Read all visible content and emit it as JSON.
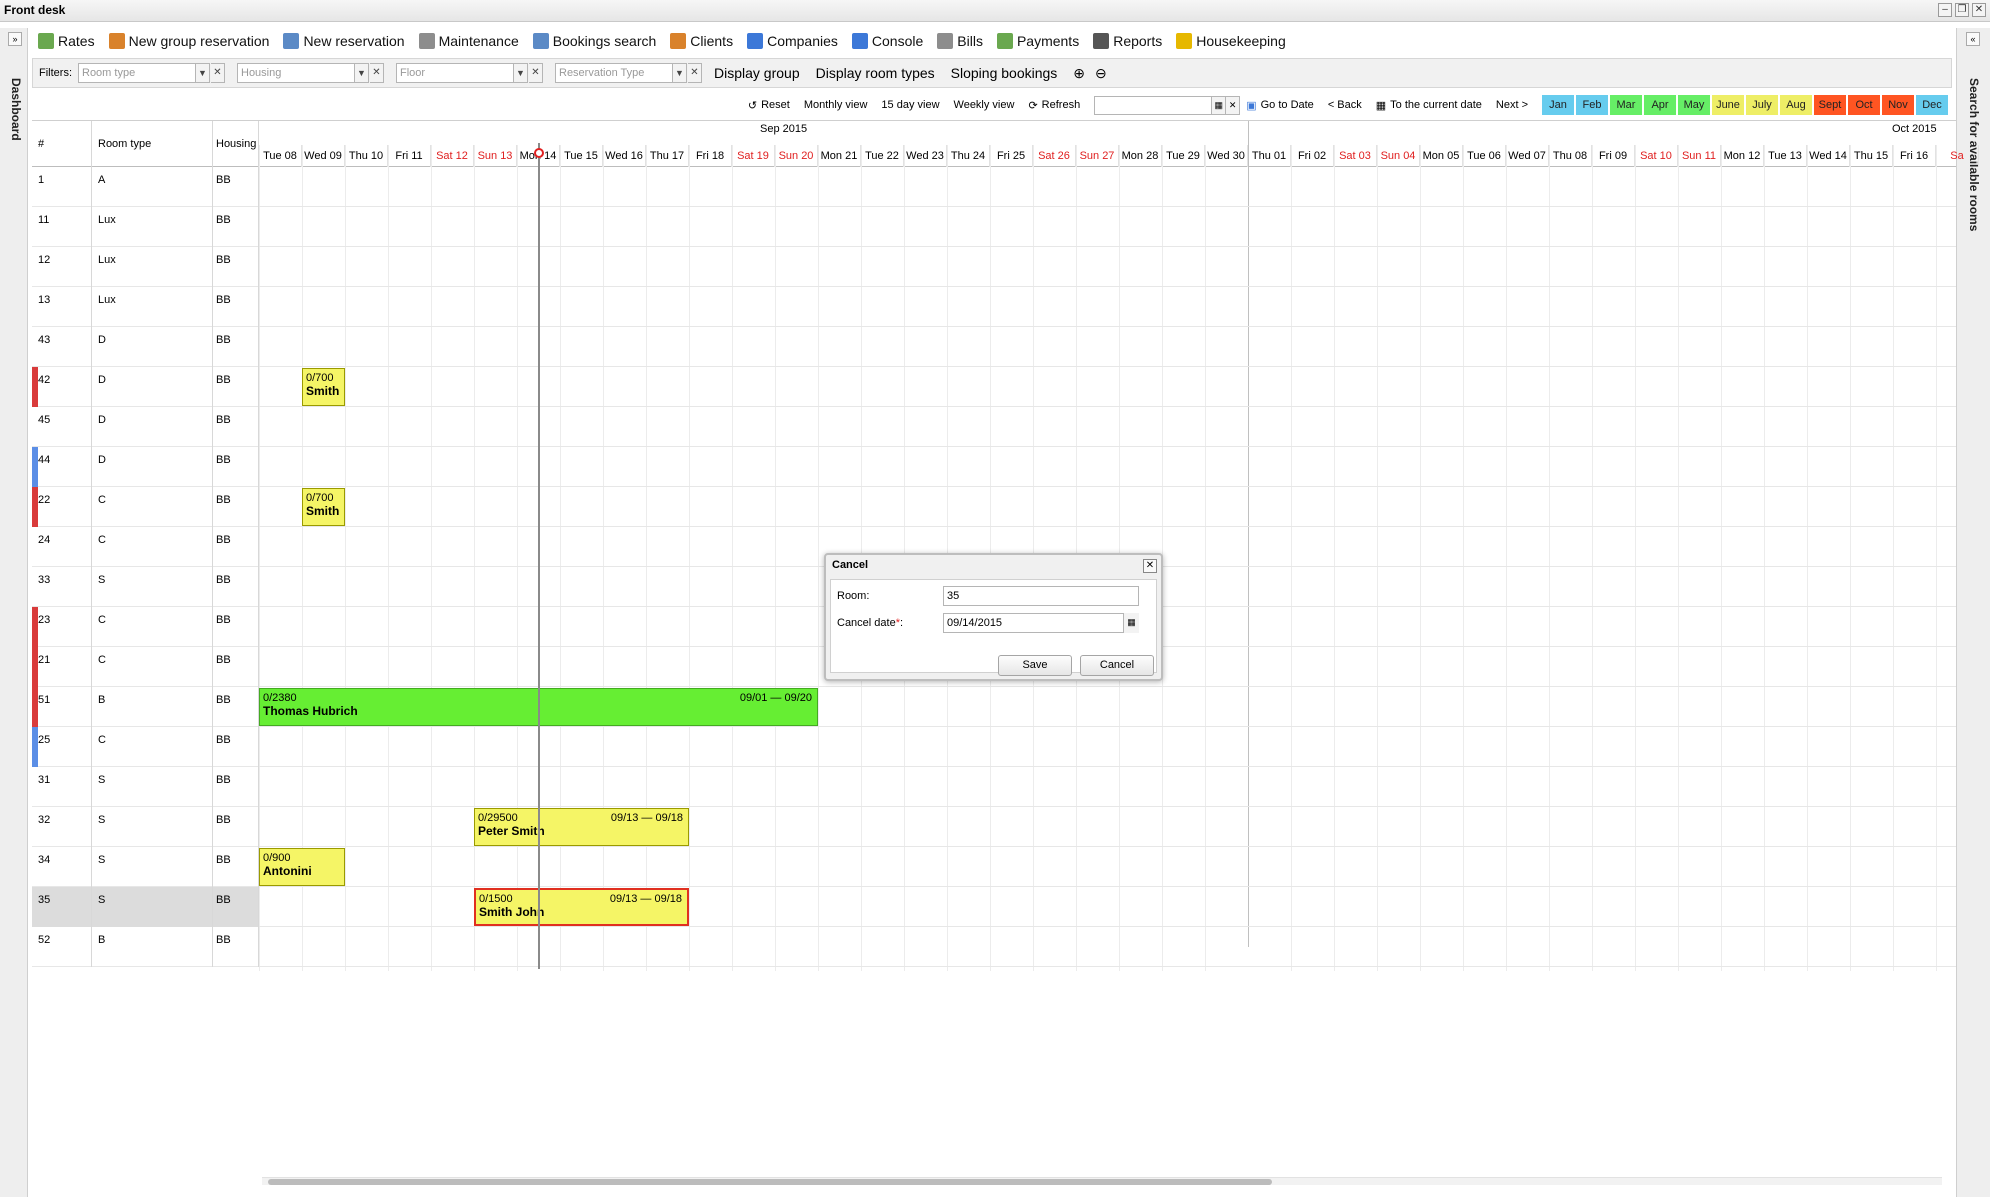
{
  "window": {
    "title": "Front desk"
  },
  "left_panel": {
    "label": "Dashboard",
    "expand_glyph": "»"
  },
  "right_panel": {
    "label": "Search for available rooms",
    "expand_glyph": "«"
  },
  "toolbar": [
    {
      "label": "Rates",
      "icon": "chart-icon",
      "color": "#6aa84f"
    },
    {
      "label": "New group reservation",
      "icon": "group-icon",
      "color": "#d9822b"
    },
    {
      "label": "New reservation",
      "icon": "key-icon",
      "color": "#5b8ac6"
    },
    {
      "label": "Maintenance",
      "icon": "wrench-icon",
      "color": "#8d8d8d"
    },
    {
      "label": "Bookings search",
      "icon": "search-icon",
      "color": "#5b8ac6"
    },
    {
      "label": "Clients",
      "icon": "user-icon",
      "color": "#d9822b"
    },
    {
      "label": "Companies",
      "icon": "building-icon",
      "color": "#3c78d8"
    },
    {
      "label": "Console",
      "icon": "window-icon",
      "color": "#3c78d8"
    },
    {
      "label": "Bills",
      "icon": "bill-icon",
      "color": "#8d8d8d"
    },
    {
      "label": "Payments",
      "icon": "dollar-icon",
      "color": "#6aa84f"
    },
    {
      "label": "Reports",
      "icon": "printer-icon",
      "color": "#555555"
    },
    {
      "label": "Housekeeping",
      "icon": "broom-icon",
      "color": "#e6b800"
    }
  ],
  "filters": {
    "label": "Filters:",
    "room_type_placeholder": "Room type",
    "housing_placeholder": "Housing",
    "floor_placeholder": "Floor",
    "reservation_type_placeholder": "Reservation Type",
    "display_group": "Display group",
    "display_room_types": "Display room types",
    "sloping_bookings": "Sloping bookings"
  },
  "nav": {
    "reset": "Reset",
    "monthly_view": "Monthly view",
    "fifteen_day_view": "15 day view",
    "weekly_view": "Weekly view",
    "refresh": "Refresh",
    "go_to_date": "Go to Date",
    "back": "< Back",
    "current_date": "To the current date",
    "next": "Next >",
    "months": [
      {
        "label": "Jan",
        "color": "#66ccee"
      },
      {
        "label": "Feb",
        "color": "#66ccee"
      },
      {
        "label": "Mar",
        "color": "#66ee66"
      },
      {
        "label": "Apr",
        "color": "#66ee66"
      },
      {
        "label": "May",
        "color": "#66ee66"
      },
      {
        "label": "June",
        "color": "#eeee66"
      },
      {
        "label": "July",
        "color": "#eeee66"
      },
      {
        "label": "Aug",
        "color": "#eeee66"
      },
      {
        "label": "Sept",
        "color": "#ff5522"
      },
      {
        "label": "Oct",
        "color": "#ff5522"
      },
      {
        "label": "Nov",
        "color": "#ff5522"
      },
      {
        "label": "Dec",
        "color": "#66ccee"
      }
    ]
  },
  "grid": {
    "col_num": "#",
    "col_room_type": "Room type",
    "col_housing": "Housing",
    "month_sep": "Sep 2015",
    "month_oct": "Oct 2015",
    "days": [
      "Tue 08",
      "Wed 09",
      "Thu 10",
      "Fri 11",
      "Sat 12",
      "Sun 13",
      "Mon 14",
      "Tue 15",
      "Wed 16",
      "Thu 17",
      "Fri 18",
      "Sat 19",
      "Sun 20",
      "Mon 21",
      "Tue 22",
      "Wed 23",
      "Thu 24",
      "Fri 25",
      "Sat 26",
      "Sun 27",
      "Mon 28",
      "Tue 29",
      "Wed 30",
      "Thu 01",
      "Fri 02",
      "Sat 03",
      "Sun 04",
      "Mon 05",
      "Tue 06",
      "Wed 07",
      "Thu 08",
      "Fri 09",
      "Sat 10",
      "Sun 11",
      "Mon 12",
      "Tue 13",
      "Wed 14",
      "Thu 15",
      "Fri 16",
      "Sa"
    ],
    "weekend_days": [
      "Sat 12",
      "Sun 13",
      "Sat 19",
      "Sun 20",
      "Sat 26",
      "Sun 27",
      "Sat 03",
      "Sun 04",
      "Sat 10",
      "Sun 11",
      "Sa"
    ],
    "today_day": "Mon 14",
    "rows": [
      {
        "num": "1",
        "type": "A",
        "housing": "BB",
        "marker": ""
      },
      {
        "num": "11",
        "type": "Lux",
        "housing": "BB",
        "marker": ""
      },
      {
        "num": "12",
        "type": "Lux",
        "housing": "BB",
        "marker": ""
      },
      {
        "num": "13",
        "type": "Lux",
        "housing": "BB",
        "marker": ""
      },
      {
        "num": "43",
        "type": "D",
        "housing": "BB",
        "marker": ""
      },
      {
        "num": "42",
        "type": "D",
        "housing": "BB",
        "marker": "#d93b3b"
      },
      {
        "num": "45",
        "type": "D",
        "housing": "BB",
        "marker": ""
      },
      {
        "num": "44",
        "type": "D",
        "housing": "BB",
        "marker": "#5b8ee6"
      },
      {
        "num": "22",
        "type": "C",
        "housing": "BB",
        "marker": "#d93b3b"
      },
      {
        "num": "24",
        "type": "C",
        "housing": "BB",
        "marker": ""
      },
      {
        "num": "33",
        "type": "S",
        "housing": "BB",
        "marker": ""
      },
      {
        "num": "23",
        "type": "C",
        "housing": "BB",
        "marker": "#d93b3b"
      },
      {
        "num": "21",
        "type": "C",
        "housing": "BB",
        "marker": "#d93b3b"
      },
      {
        "num": "51",
        "type": "B",
        "housing": "BB",
        "marker": "#d93b3b"
      },
      {
        "num": "25",
        "type": "C",
        "housing": "BB",
        "marker": "#5b8ee6"
      },
      {
        "num": "31",
        "type": "S",
        "housing": "BB",
        "marker": ""
      },
      {
        "num": "32",
        "type": "S",
        "housing": "BB",
        "marker": ""
      },
      {
        "num": "34",
        "type": "S",
        "housing": "BB",
        "marker": ""
      },
      {
        "num": "35",
        "type": "S",
        "housing": "BB",
        "marker": "#5b8ee6",
        "selected": true
      },
      {
        "num": "52",
        "type": "B",
        "housing": "BB",
        "marker": ""
      }
    ],
    "bookings": [
      {
        "room": "42",
        "start_day": "Wed 09",
        "end_day": "Wed 09",
        "amount": "0/700",
        "name": "Smith",
        "dates": "",
        "style": "yellow"
      },
      {
        "room": "22",
        "start_day": "Wed 09",
        "end_day": "Wed 09",
        "amount": "0/700",
        "name": "Smith",
        "dates": "",
        "style": "yellow"
      },
      {
        "room": "51",
        "start_day": "Tue 08",
        "end_day": "Sun 20",
        "amount": "0/2380",
        "name": "Thomas Hubrich",
        "dates": "09/01 — 09/20",
        "style": "green"
      },
      {
        "room": "32",
        "start_day": "Sun 13",
        "end_day": "Thu 17",
        "amount": "0/29500",
        "name": "Peter Smith",
        "dates": "09/13 — 09/18",
        "style": "yellow"
      },
      {
        "room": "34",
        "start_day": "Tue 08",
        "end_day": "Wed 09",
        "amount": "0/900",
        "name": "Antonini",
        "dates": "",
        "style": "yellow"
      },
      {
        "room": "35",
        "start_day": "Sun 13",
        "end_day": "Thu 17",
        "amount": "0/1500",
        "name": "Smith John",
        "dates": "09/13 — 09/18",
        "style": "yellow red"
      }
    ]
  },
  "dialog": {
    "title": "Cancel",
    "room_label": "Room:",
    "room_value": "35",
    "cancel_date_label": "Cancel date",
    "required_mark": "*",
    "colon": ":",
    "cancel_date_value": "09/14/2015",
    "save_label": "Save",
    "cancel_label": "Cancel"
  }
}
